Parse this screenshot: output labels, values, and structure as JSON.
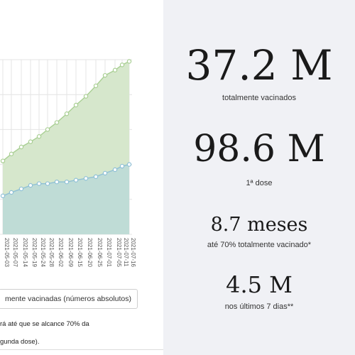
{
  "chart_data": {
    "type": "area",
    "x": [
      "2021-05-03",
      "2021-05-07",
      "2021-05-14",
      "2021-05-19",
      "2021-05-24",
      "2021-05-28",
      "2021-06-02",
      "2021-06-09",
      "2021-06-15",
      "2021-06-20",
      "2021-06-25",
      "2021-07-01",
      "2021-07-05",
      "2021-07-11",
      "2021-07-16"
    ],
    "series": [
      {
        "values": [
          42,
          46,
          50,
          53,
          56,
          60,
          64,
          69,
          74,
          79,
          85,
          91,
          94,
          97,
          99
        ]
      },
      {
        "values": [
          22,
          24,
          26,
          28,
          29,
          29,
          30,
          30,
          31,
          32,
          33,
          35,
          37,
          39,
          40
        ]
      }
    ],
    "colors": {
      "first_dose": "#d6e7cc",
      "first_dose_line": "#a9cf93",
      "fully": "#bfdcd6",
      "fully_line": "#8fc0d6"
    },
    "grid": true
  },
  "toggle_label": "mente vacinadas (números absolutos)",
  "note_line1": "rá até que se alcance 70% da",
  "note_line2": "gunda dose).",
  "stats": [
    {
      "value": "37.2 M",
      "label": "totalmente vacinados"
    },
    {
      "value": "98.6 M",
      "label": "1ª dose"
    },
    {
      "value": "8.7 meses",
      "label": "até 70% totalmente vacinado*"
    },
    {
      "value": "4.5 M",
      "label": "nos últimos 7 dias**"
    }
  ]
}
